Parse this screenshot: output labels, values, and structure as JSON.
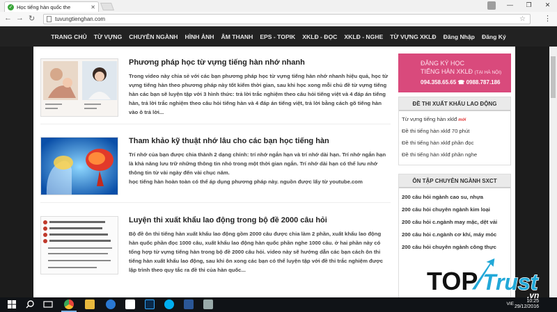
{
  "browser": {
    "tab_title": "Học tiếng hàn quốc the",
    "url": "tuvungtienghan.com"
  },
  "nav": [
    "TRANG CHỦ",
    "TỪ VỰNG",
    "CHUYÊN NGÀNH",
    "HÌNH ẢNH",
    "ÂM THANH",
    "EPS - TOPIK",
    "XKLĐ - ĐỌC",
    "XKLĐ - NGHE",
    "TỪ VỰNG XKLĐ",
    "Đăng Nhập",
    "Đăng Ký"
  ],
  "posts": [
    {
      "title": "Phương pháp học từ vựng tiếng hàn nhớ nhanh",
      "excerpt": "Trong video này chia sẻ với các bạn phương pháp học từ vựng tiếng hàn nhớ nhanh hiệu quả, học từ vựng tiếng hàn theo phương pháp này tốt kiếm thời gian, sau khi học xong mỗi chủ đề từ vựng tiếng hàn các bạn sẽ luyện tập với 3 hình thức: trả lời trắc nghiệm theo câu hỏi tiếng việt và 4 đáp án tiếng hàn, trả lời trắc nghiệm theo câu hỏi tiếng hàn và 4 đáp án tiếng việt, trả lời bằng cách gõ tiếng hàn vào ô trả lời..."
    },
    {
      "title": "Tham khảo kỹ thuật nhớ lâu cho các bạn học tiếng hàn",
      "excerpt": "Trí nhớ của bạn được chia thành 2 dạng chính:  trí nhớ ngắn hạn và trí nhớ dài hạn. Trí nhớ ngắn hạn là khả năng lưu trữ những thông tin nhỏ trong một thời gian ngắn. Trí nhớ dài hạn có thể lưu nhớ thông tin từ vài ngày đến vài chục năm.\nhọc tiếng hàn hoàn toàn có thể áp dụng phương pháp này.  nguồn được lấy từ youtube.com"
    },
    {
      "title": "Luyện thi xuất khẩu lao động trong bộ đề 2000 câu hỏi",
      "excerpt": "Bộ đề ôn thi tiếng hàn xuất khẩu lao động gồm 2000 câu được chia làm 2 phần, xuất khẩu lao động hàn quốc phần đọc 1000 câu, xuất khẩu lao động hàn quốc phần nghe 1000 câu. ở hai phần này có tổng hợp từ vựng tiếng hàn trong bộ đề 2000 câu hỏi. video này sẽ hướng dẫn các bạn cách ôn thi tiếng hàn xuất khẩu lao động, sau khi ôn xong các bạn có thể luyện tập với đề thi trắc nghiệm được lập trình theo quy tắc ra đề thi của hàn quốc..."
    }
  ],
  "banner": {
    "line1": "ĐĂNG KÝ HỌC",
    "line2": "TIẾNG HÀN XKLĐ",
    "line2_small": "(TẠI HÀ NỘI)",
    "phones": "094.358.65.65  ☎ 0988.787.186"
  },
  "widget1": {
    "title": "ĐỀ THI XUẤT KHẨU LAO ĐỘNG",
    "items": [
      "Từ vựng tiếng hàn xklđ",
      "Đề thi tiếng hàn xklđ 70 phút",
      "Đề thi tiếng hàn xklđ phần đọc",
      "Đề thi tiếng hàn xklđ phần nghe"
    ],
    "new_badge": "mới"
  },
  "widget2": {
    "title": "ÔN TẬP CHUYÊN NGÀNH SXCT",
    "items": [
      "200 câu hỏi ngành cao su, nhựa",
      "200 câu hỏi chuyên ngành kim loại",
      "200 câu hỏi c.ngành may mặc, dệt vải",
      "200 câu hỏi c.ngành cơ khí, máy móc",
      "200 câu hỏi chuyên ngành công thực"
    ]
  },
  "taskbar": {
    "lang": "VIE",
    "time": "10:25",
    "date": "29/12/2016"
  },
  "watermark": {
    "brand": "TOP",
    "brand2": "Trust",
    "tld": ".vn"
  },
  "colors": {
    "nav_bg": "#222222",
    "banner": "#d94a7c",
    "watermark": "#22a8d8"
  }
}
